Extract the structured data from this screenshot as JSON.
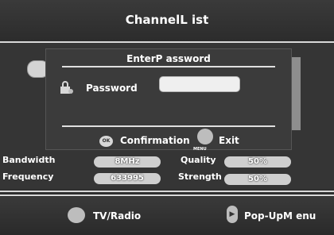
{
  "header": {
    "title": "ChannelL ist"
  },
  "dialog": {
    "title": "EnterP assword",
    "password_label": "Password",
    "password_value": "",
    "confirm_icon_text": "OK",
    "confirm_label": "Confirmation",
    "exit_label": "Exit",
    "exit_caption": "MENU"
  },
  "info": {
    "bandwidth_label": "Bandwidth",
    "bandwidth_value": "8MHz",
    "quality_label": "Quality",
    "quality_value": "50%",
    "frequency_label": "Frequency",
    "frequency_value": "633995",
    "strength_label": "Strength",
    "strength_value": "50%"
  },
  "footer": {
    "tv_radio_label": "TV/Radio",
    "popup_menu_label": "Pop-UpM enu"
  },
  "colors": {
    "background": "#2f2f2f",
    "dialog": "#3b3b3b",
    "accent": "#d8d8d8"
  },
  "icons": {
    "lock": "lock-icon",
    "ok": "ok-button-icon",
    "exit": "exit-button-icon"
  }
}
